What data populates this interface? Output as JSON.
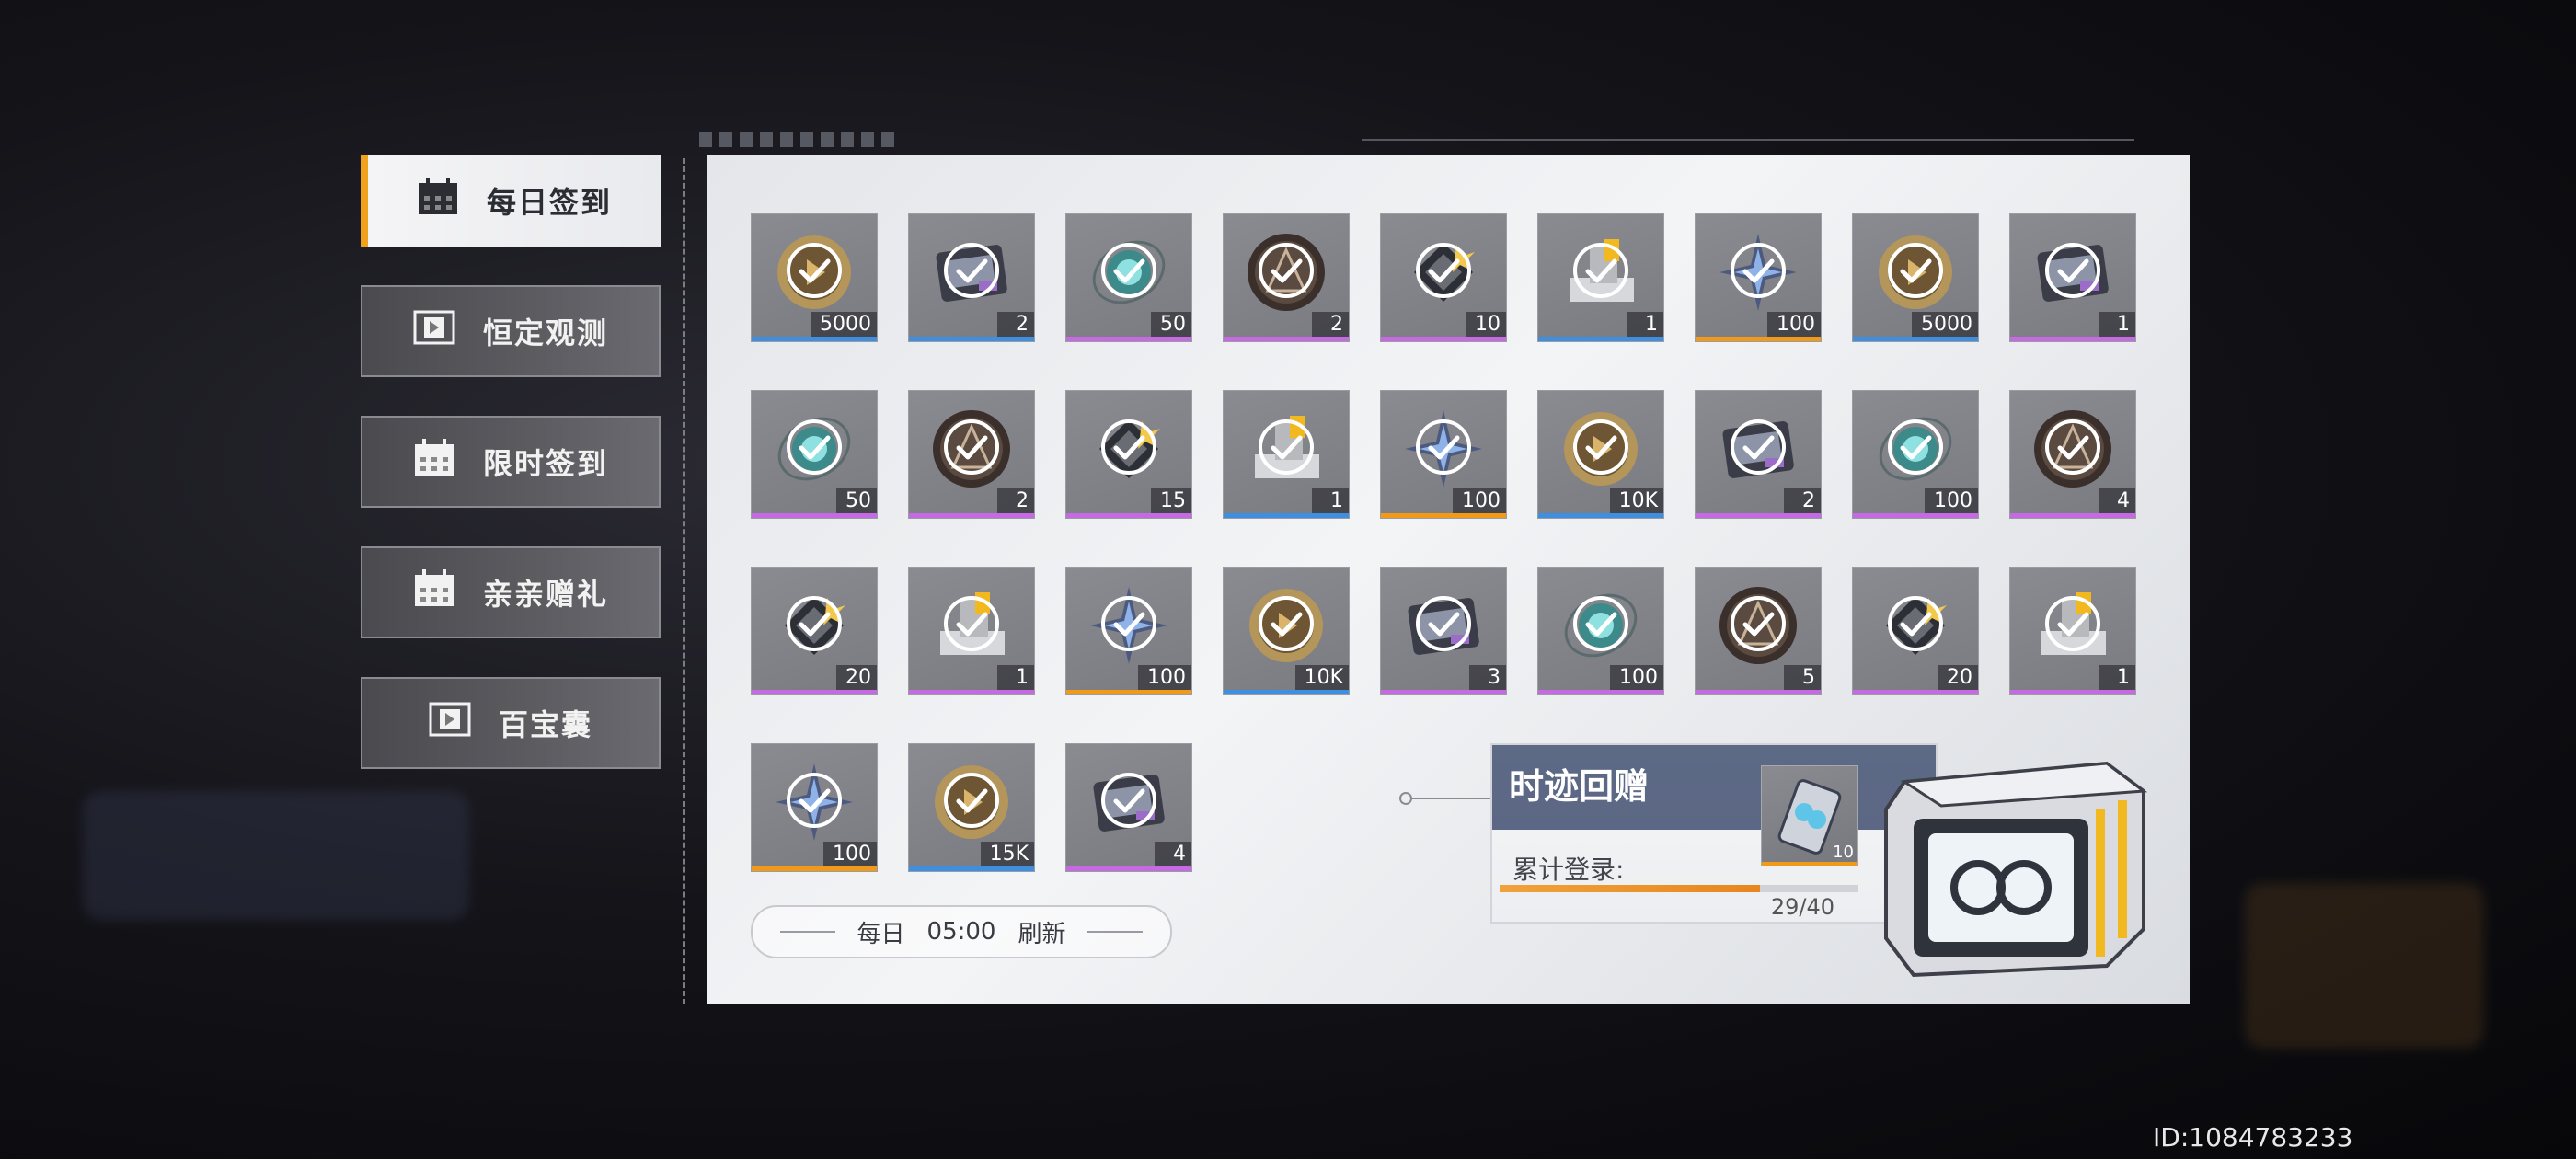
{
  "sidebar": {
    "items": [
      {
        "label": "每日签到",
        "active": true,
        "icon": "calendar-icon"
      },
      {
        "label": "恒定观测",
        "active": false,
        "icon": "ticket-icon"
      },
      {
        "label": "限时签到",
        "active": false,
        "icon": "calendar-icon"
      },
      {
        "label": "亲亲赠礼",
        "active": false,
        "icon": "calendar-icon"
      },
      {
        "label": "百宝囊",
        "active": false,
        "icon": "ticket-icon"
      }
    ]
  },
  "daily_rewards": [
    {
      "item": "gold-coin",
      "qty": "5000",
      "rarity": "blue",
      "claimed": true
    },
    {
      "item": "device",
      "qty": "2",
      "rarity": "blue",
      "claimed": true
    },
    {
      "item": "teal-chip",
      "qty": "50",
      "rarity": "purple",
      "claimed": true
    },
    {
      "item": "dark-medal",
      "qty": "2",
      "rarity": "purple",
      "claimed": true
    },
    {
      "item": "gold-cube",
      "qty": "10",
      "rarity": "purple",
      "claimed": true
    },
    {
      "item": "machine",
      "qty": "1",
      "rarity": "blue",
      "claimed": true
    },
    {
      "item": "star-shard",
      "qty": "100",
      "rarity": "orange",
      "claimed": true
    },
    {
      "item": "gold-coin",
      "qty": "5000",
      "rarity": "blue",
      "claimed": true
    },
    {
      "item": "device",
      "qty": "1",
      "rarity": "purple",
      "claimed": true
    },
    {
      "item": "teal-chip",
      "qty": "50",
      "rarity": "purple",
      "claimed": true
    },
    {
      "item": "dark-medal",
      "qty": "2",
      "rarity": "purple",
      "claimed": true
    },
    {
      "item": "gold-cube",
      "qty": "15",
      "rarity": "purple",
      "claimed": true
    },
    {
      "item": "machine",
      "qty": "1",
      "rarity": "blue",
      "claimed": true
    },
    {
      "item": "star-shard",
      "qty": "100",
      "rarity": "orange",
      "claimed": true
    },
    {
      "item": "gold-coin",
      "qty": "10K",
      "rarity": "blue",
      "claimed": true
    },
    {
      "item": "device",
      "qty": "2",
      "rarity": "purple",
      "claimed": true
    },
    {
      "item": "teal-chip",
      "qty": "100",
      "rarity": "purple",
      "claimed": true
    },
    {
      "item": "dark-medal",
      "qty": "4",
      "rarity": "purple",
      "claimed": true
    },
    {
      "item": "gold-cube",
      "qty": "20",
      "rarity": "purple",
      "claimed": true
    },
    {
      "item": "machine",
      "qty": "1",
      "rarity": "purple",
      "claimed": true
    },
    {
      "item": "star-shard",
      "qty": "100",
      "rarity": "orange",
      "claimed": true
    },
    {
      "item": "gold-coin",
      "qty": "10K",
      "rarity": "blue",
      "claimed": true
    },
    {
      "item": "device",
      "qty": "3",
      "rarity": "purple",
      "claimed": true
    },
    {
      "item": "teal-chip",
      "qty": "100",
      "rarity": "purple",
      "claimed": true
    },
    {
      "item": "dark-medal",
      "qty": "5",
      "rarity": "purple",
      "claimed": true
    },
    {
      "item": "gold-cube",
      "qty": "20",
      "rarity": "purple",
      "claimed": true
    },
    {
      "item": "machine",
      "qty": "1",
      "rarity": "purple",
      "claimed": true
    },
    {
      "item": "star-shard",
      "qty": "100",
      "rarity": "orange",
      "claimed": true
    },
    {
      "item": "gold-coin",
      "qty": "15K",
      "rarity": "blue",
      "claimed": true
    },
    {
      "item": "device",
      "qty": "4",
      "rarity": "purple",
      "claimed": true
    }
  ],
  "rarity_colors": {
    "blue": "#3f8fe0",
    "purple": "#c56ae3",
    "orange": "#f19a19"
  },
  "refresh": {
    "prefix": "每日",
    "time": "05:00",
    "suffix": "刷新"
  },
  "cumulative": {
    "title": "时迹回赠",
    "reward_qty": "10",
    "login_label": "累计登录:",
    "progress_text": "29/40",
    "progress_fraction": 0.725
  },
  "player_id": "ID:1084783233"
}
